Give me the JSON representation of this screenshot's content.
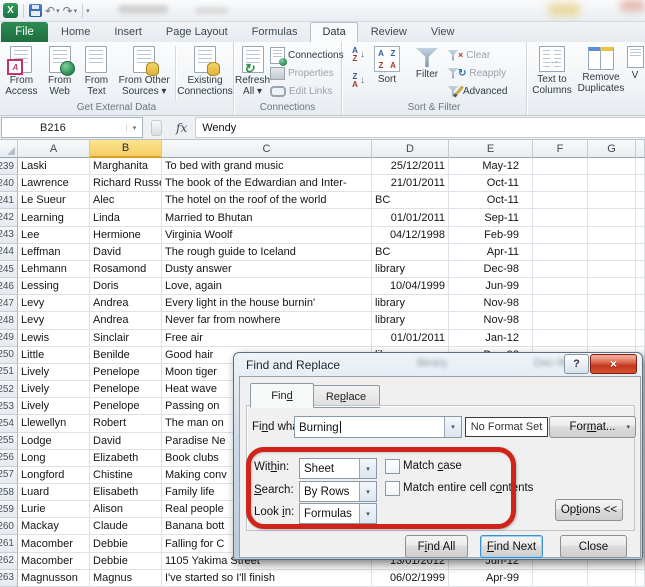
{
  "glyphs": {
    "dropdown": "▾",
    "arrow_down": "↓",
    "refresh": "↻",
    "undo": "↶",
    "redo": "↷",
    "close": "×",
    "help": "?",
    "letter_a": "A",
    "letter_z": "Z",
    "ttc_arrow": "→",
    "clear_x": "×",
    "reapply_r": "↻"
  },
  "titlebar": {
    "excel_logo": "X"
  },
  "tabs": {
    "file": "File",
    "items": [
      "Home",
      "Insert",
      "Page Layout",
      "Formulas",
      "Data",
      "Review",
      "View"
    ],
    "active": "Data"
  },
  "ribbon": {
    "get_external_data": {
      "label": "Get External Data",
      "from_access": "From Access",
      "from_web": "From Web",
      "from_text": "From Text",
      "from_other": "From Other Sources ▾",
      "existing": "Existing Connections"
    },
    "connections": {
      "label": "Connections",
      "refresh_all": "Refresh All ▾",
      "connections": "Connections",
      "properties": "Properties",
      "edit_links": "Edit Links"
    },
    "sort_filter": {
      "label": "Sort & Filter",
      "sort": "Sort",
      "filter": "Filter",
      "clear": "Clear",
      "reapply": "Reapply",
      "advanced": "Advanced"
    },
    "data_tools": {
      "text_to_columns": "Text to Columns",
      "remove_duplicates": "Remove Duplicates",
      "partial": "V"
    }
  },
  "formula_bar": {
    "name_box": "B216",
    "fx_label": "fx",
    "value": "Wendy"
  },
  "sheet": {
    "columns": [
      "A",
      "B",
      "C",
      "D",
      "E",
      "F",
      "G"
    ],
    "selected_column": "B",
    "rows": [
      {
        "n": "239",
        "a": "Laski",
        "b": "Marghanita",
        "c": "To bed with grand music",
        "d": "25/12/2011",
        "d_left": false,
        "e": "May-12"
      },
      {
        "n": "240",
        "a": "Lawrence",
        "b": "Richard Russell",
        "c": "The book of the Edwardian and Inter-",
        "d": "21/01/2011",
        "d_left": false,
        "e": "Oct-11"
      },
      {
        "n": "241",
        "a": "Le Sueur",
        "b": "Alec",
        "c": "The hotel on the roof of the world",
        "d": "BC",
        "d_left": true,
        "e": "Oct-11"
      },
      {
        "n": "242",
        "a": "Learning",
        "b": "Linda",
        "c": "Married to Bhutan",
        "d": "01/01/2011",
        "d_left": false,
        "e": "Sep-11"
      },
      {
        "n": "243",
        "a": "Lee",
        "b": "Hermione",
        "c": "Virginia Woolf",
        "d": "04/12/1998",
        "d_left": false,
        "e": "Feb-99"
      },
      {
        "n": "244",
        "a": "Leffman",
        "b": "David",
        "c": "The rough guide to Iceland",
        "d": "BC",
        "d_left": true,
        "e": "Apr-11"
      },
      {
        "n": "245",
        "a": "Lehmann",
        "b": "Rosamond",
        "c": "Dusty answer",
        "d": "library",
        "d_left": true,
        "e": "Dec-98"
      },
      {
        "n": "246",
        "a": "Lessing",
        "b": "Doris",
        "c": "Love, again",
        "d": "10/04/1999",
        "d_left": false,
        "e": "Jun-99"
      },
      {
        "n": "247",
        "a": "Levy",
        "b": "Andrea",
        "c": "Every light in the house burnin'",
        "d": "library",
        "d_left": true,
        "e": "Nov-98"
      },
      {
        "n": "248",
        "a": "Levy",
        "b": "Andrea",
        "c": "Never far from nowhere",
        "d": "library",
        "d_left": true,
        "e": "Nov-98"
      },
      {
        "n": "249",
        "a": "Lewis",
        "b": "Sinclair",
        "c": "Free air",
        "d": "01/01/2011",
        "d_left": false,
        "e": "Jan-12"
      },
      {
        "n": "250",
        "a": "Little",
        "b": "Benilde",
        "c": "Good hair",
        "d": "library",
        "d_left": true,
        "e": "Dec-98"
      },
      {
        "n": "251",
        "a": "Lively",
        "b": "Penelope",
        "c": "Moon tiger",
        "d": "",
        "d_left": true,
        "e": ""
      },
      {
        "n": "252",
        "a": "Lively",
        "b": "Penelope",
        "c": "Heat wave",
        "d": "",
        "d_left": true,
        "e": ""
      },
      {
        "n": "253",
        "a": "Lively",
        "b": "Penelope",
        "c": "Passing on",
        "d": "",
        "d_left": true,
        "e": ""
      },
      {
        "n": "254",
        "a": "Llewellyn",
        "b": "Robert",
        "c": "The man on",
        "d": "",
        "d_left": true,
        "e": ""
      },
      {
        "n": "255",
        "a": "Lodge",
        "b": "David",
        "c": "Paradise Ne",
        "d": "",
        "d_left": true,
        "e": ""
      },
      {
        "n": "256",
        "a": "Long",
        "b": "Elizabeth",
        "c": "Book clubs",
        "d": "",
        "d_left": true,
        "e": ""
      },
      {
        "n": "257",
        "a": "Longford",
        "b": "Chistine",
        "c": "Making conv",
        "d": "",
        "d_left": true,
        "e": ""
      },
      {
        "n": "258",
        "a": "Luard",
        "b": "Elisabeth",
        "c": "Family life",
        "d": "",
        "d_left": true,
        "e": ""
      },
      {
        "n": "259",
        "a": "Lurie",
        "b": "Alison",
        "c": "Real people",
        "d": "",
        "d_left": true,
        "e": ""
      },
      {
        "n": "260",
        "a": "Mackay",
        "b": "Claude",
        "c": "Banana bott",
        "d": "",
        "d_left": true,
        "e": ""
      },
      {
        "n": "261",
        "a": "Macomber",
        "b": "Debbie",
        "c": "Falling for C",
        "d": "",
        "d_left": true,
        "e": ""
      },
      {
        "n": "262",
        "a": "Macomber",
        "b": "Debbie",
        "c": "1105 Yakima Street",
        "d": "13/01/2012",
        "d_left": false,
        "e": "Jun-12"
      },
      {
        "n": "263",
        "a": "Magnusson",
        "b": "Magnus",
        "c": "I've started so I'll finish",
        "d": "06/02/1999",
        "d_left": false,
        "e": "Apr-99"
      }
    ]
  },
  "dialog": {
    "title": "Find and Replace",
    "glass_hints": [
      "library",
      "Dec-98"
    ],
    "tab_find": {
      "pre": "Fin",
      "key": "d",
      "post": ""
    },
    "tab_replace": {
      "pre": "Re",
      "key": "p",
      "post": "lace"
    },
    "find_what": {
      "pre": "Fi",
      "key": "n",
      "post": "d what:"
    },
    "find_value": "Burning",
    "no_format": "No Format Set",
    "format_btn": {
      "pre": "For",
      "key": "m",
      "post": "at..."
    },
    "within": {
      "pre": "Wit",
      "key": "h",
      "post": "in:"
    },
    "within_value": "Sheet",
    "search": {
      "pre": "",
      "key": "S",
      "post": "earch:"
    },
    "search_value": "By Rows",
    "look_in": {
      "pre": "Look ",
      "key": "i",
      "post": "n:"
    },
    "look_in_value": "Formulas",
    "match_case": {
      "pre": "Match ",
      "key": "c",
      "post": "ase"
    },
    "match_entire": {
      "pre": "Match entire cell c",
      "key": "o",
      "post": "ntents"
    },
    "options_btn": {
      "pre": "Op",
      "key": "t",
      "post": "ions <<"
    },
    "find_all": {
      "pre": "F",
      "key": "i",
      "post": "nd All"
    },
    "find_next": {
      "pre": "",
      "key": "F",
      "post": "ind Next"
    },
    "close_btn": "Close"
  },
  "annotation_color": "#cf2419"
}
